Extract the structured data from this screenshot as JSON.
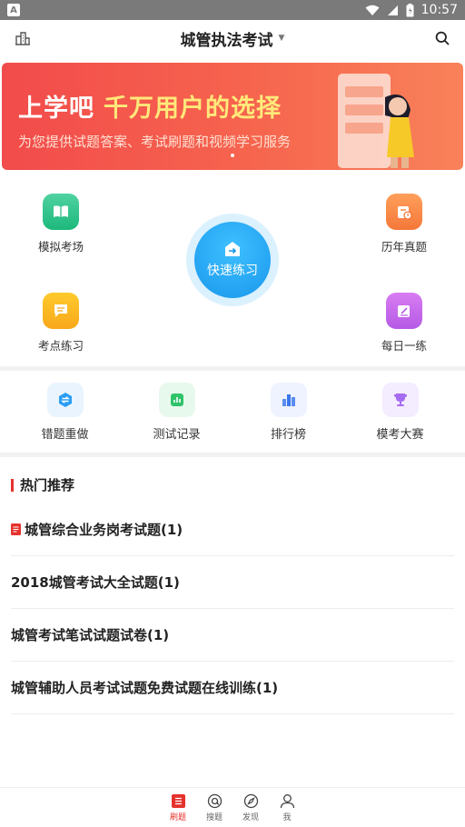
{
  "status_bar": {
    "time": "10:57",
    "left_badge": "A"
  },
  "header": {
    "title": "城管执法考试"
  },
  "banner": {
    "headline_part1": "上学吧",
    "headline_part2": "千万用户的选择",
    "subtitle": "为您提供试题答案、考试刷题和视频学习服务"
  },
  "main_entries": {
    "mock_exam": "模拟考场",
    "past_papers": "历年真题",
    "point_practice": "考点练习",
    "daily_practice": "每日一练",
    "quick_practice": "快速练习"
  },
  "tools": [
    {
      "label": "错题重做"
    },
    {
      "label": "测试记录"
    },
    {
      "label": "排行榜"
    },
    {
      "label": "模考大赛"
    }
  ],
  "hot": {
    "title": "热门推荐",
    "items": [
      {
        "text": "城管综合业务岗考试题(1)"
      },
      {
        "text": "2018城管考试大全试题(1)"
      },
      {
        "text": "城管考试笔试试题试卷(1)"
      },
      {
        "text": "城管辅助人员考试试题免费试题在线训练(1)"
      }
    ]
  },
  "bottom_nav": [
    {
      "label": "刷题"
    },
    {
      "label": "搜题"
    },
    {
      "label": "发现"
    },
    {
      "label": "我"
    }
  ],
  "colors": {
    "accent": "#e5322d",
    "banner_start": "#f24b4b",
    "banner_end": "#f9825a",
    "quick": "#1897ec"
  }
}
